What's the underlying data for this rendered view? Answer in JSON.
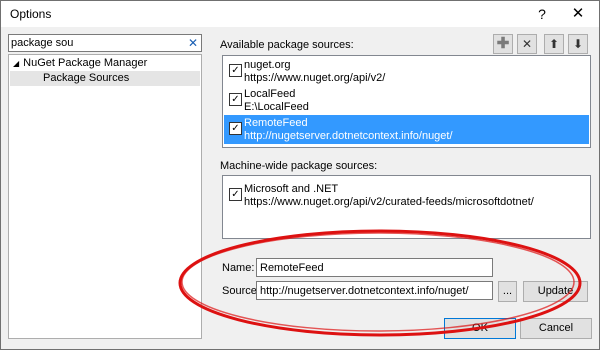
{
  "window": {
    "title": "Options",
    "help_label": "?",
    "close_label": "✕"
  },
  "left": {
    "search": {
      "value": "package sou",
      "clear_label": "✕"
    },
    "tree": {
      "parent_expander": "◢",
      "parent_label": "NuGet Package Manager",
      "child_label": "Package Sources"
    }
  },
  "available": {
    "label": "Available package sources:",
    "toolbar": {
      "add_label": "✚",
      "remove_label": "✕",
      "up_label": "⬆",
      "down_label": "⬇"
    },
    "items": [
      {
        "name": "nuget.org",
        "url": "https://www.nuget.org/api/v2/",
        "checked": true,
        "selected": false
      },
      {
        "name": "LocalFeed",
        "url": "E:\\LocalFeed",
        "checked": true,
        "selected": false
      },
      {
        "name": "RemoteFeed",
        "url": "http://nugetserver.dotnetcontext.info/nuget/",
        "checked": true,
        "selected": true
      }
    ],
    "check_mark": "✓"
  },
  "machine_wide": {
    "label": "Machine-wide package sources:",
    "items": [
      {
        "name": "Microsoft and .NET",
        "url": "https://www.nuget.org/api/v2/curated-feeds/microsoftdotnet/",
        "checked": true
      }
    ]
  },
  "form": {
    "name_label": "Name:",
    "name_value": "RemoteFeed",
    "source_label": "Source:",
    "source_value": "http://nugetserver.dotnetcontext.info/nuget/",
    "browse_label": "...",
    "update_label": "Update"
  },
  "footer": {
    "ok_label": "OK",
    "cancel_label": "Cancel"
  },
  "colors": {
    "selection": "#3399ff",
    "annotation_ellipse": "#dd1111"
  }
}
